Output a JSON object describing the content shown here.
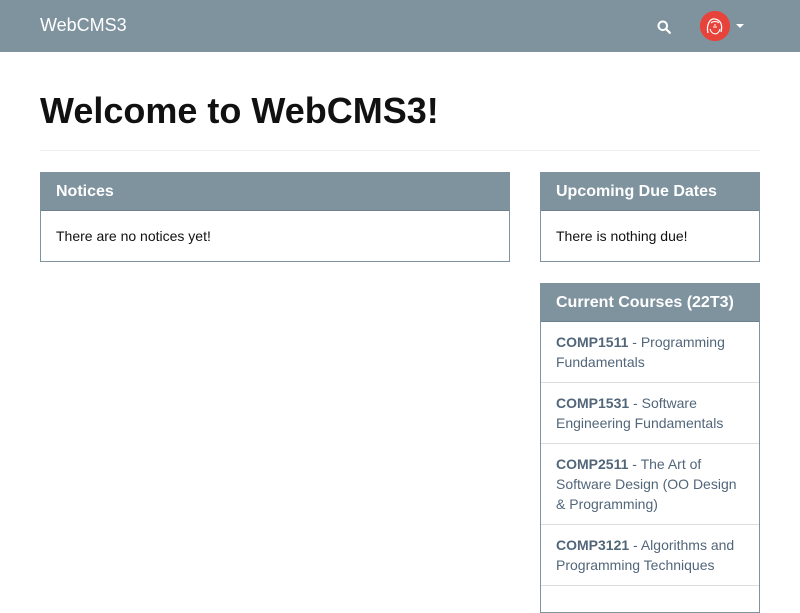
{
  "navbar": {
    "brand": "WebCMS3",
    "search_icon": "search-icon",
    "colors": {
      "background": "#7f939f",
      "text": "#ffffff",
      "avatar": "#e8433a"
    }
  },
  "page": {
    "title": "Welcome to WebCMS3!"
  },
  "notices": {
    "heading": "Notices",
    "body": "There are no notices yet!"
  },
  "due_dates": {
    "heading": "Upcoming Due Dates",
    "body": "There is nothing due!"
  },
  "courses": {
    "heading": "Current Courses (22T3)",
    "separator": " - ",
    "items": [
      {
        "code": "COMP1511",
        "name": "Programming Fundamentals"
      },
      {
        "code": "COMP1531",
        "name": "Software Engineering Fundamentals"
      },
      {
        "code": "COMP2511",
        "name": "The Art of Software Design (OO Design & Programming)"
      },
      {
        "code": "COMP3121",
        "name": "Algorithms and Programming Techniques"
      }
    ]
  }
}
